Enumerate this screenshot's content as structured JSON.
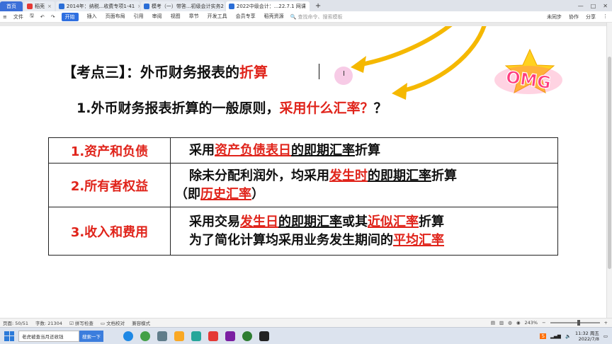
{
  "tabs": [
    {
      "label": "首页",
      "kind": "home"
    },
    {
      "label": "稻壳",
      "kind": "normal",
      "color": "#e53935"
    },
    {
      "label": "2014年：纳税...收费专项1-41",
      "kind": "normal",
      "color": "#2b6ed6"
    },
    {
      "label": "模考（一）带答...初级会计实务2",
      "kind": "normal",
      "color": "#2b6ed6"
    },
    {
      "label": "2022中级会计：...22.7.1 网课",
      "kind": "active",
      "color": "#2b6ed6"
    }
  ],
  "tab_new": "+",
  "window_controls": {
    "minimize": "—",
    "maximize": "□",
    "close": "✕"
  },
  "menubar": {
    "file": "文件",
    "items": [
      "开始",
      "插入",
      "页面布局",
      "引用",
      "审阅",
      "视图",
      "章节",
      "开发工具",
      "会员专享",
      "稻壳资源"
    ],
    "search_placeholder": "查找命令、搜索模板",
    "sync": "未同步",
    "collab": "协作",
    "share": "分享"
  },
  "doc": {
    "title_prefix": "【考点三】：外币财务报表的",
    "title_red": "折算",
    "subtitle_prefix": "1.外币财务报表折算的一般原则，",
    "subtitle_red": "采用什么汇率？",
    "subtitle_suffix": "？",
    "rows": [
      {
        "label": "1.资产和负债",
        "line1": [
          {
            "t": "采用",
            "s": ""
          },
          {
            "t": "资产负债表日",
            "s": "red ul"
          },
          {
            "t": "的即期汇率",
            "s": "ul"
          },
          {
            "t": "折算",
            "s": ""
          }
        ],
        "line2": []
      },
      {
        "label": "2.所有者权益",
        "line1": [
          {
            "t": "除未分配利润外，均采用",
            "s": ""
          },
          {
            "t": "发生时",
            "s": "red ul"
          },
          {
            "t": "的即期汇率",
            "s": "ul"
          },
          {
            "t": "折算",
            "s": ""
          }
        ],
        "line2": [
          {
            "t": "（即",
            "s": ""
          },
          {
            "t": "历史汇率",
            "s": "red ul"
          },
          {
            "t": "）",
            "s": ""
          }
        ]
      },
      {
        "label": "3.收入和费用",
        "line1": [
          {
            "t": "采用交易",
            "s": ""
          },
          {
            "t": "发生日",
            "s": "red ul"
          },
          {
            "t": "的即期汇率",
            "s": "ul"
          },
          {
            "t": "或其",
            "s": ""
          },
          {
            "t": "近似汇率",
            "s": "red ul"
          },
          {
            "t": "折算",
            "s": ""
          }
        ],
        "line2": [
          {
            "t": "为了简化计算均采用业务发生期间的",
            "s": ""
          },
          {
            "t": "平均汇率",
            "s": "red ul"
          }
        ]
      }
    ],
    "sticker_text": "OMG"
  },
  "statusbar": {
    "page": "页面: 50/51",
    "words": "字数: 21304",
    "spell": "拼写检查",
    "proof": "文档校对",
    "compat": "兼容模式",
    "zoom": "243%"
  },
  "taskbar": {
    "search_text": "老虎被查当月还收钱",
    "search_button": "搜索一下",
    "time": "11:32 周五",
    "date": "2022/7/8"
  },
  "colors": {
    "accent_red": "#e0241b",
    "arrow_yellow": "#f5b800",
    "wps_blue": "#2f6fe0"
  }
}
